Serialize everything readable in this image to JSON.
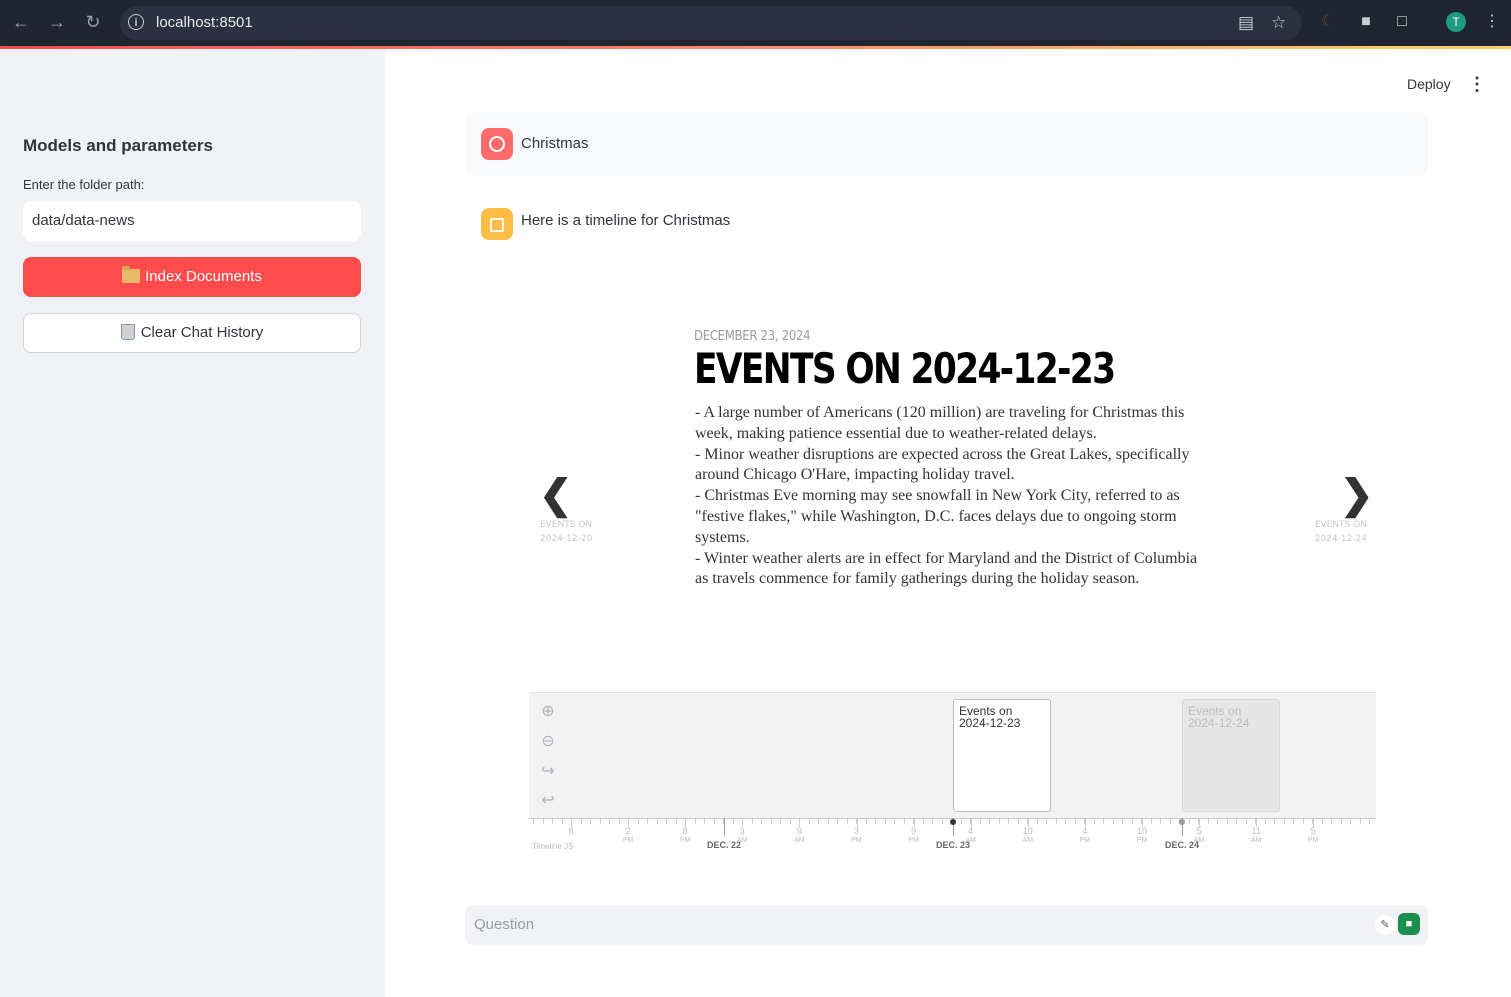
{
  "browser": {
    "url": "localhost:8501",
    "profile_initial": "T"
  },
  "sidebar": {
    "title": "Models and parameters",
    "folder_label": "Enter the folder path:",
    "folder_value": "data/data-news",
    "index_button": "Index Documents",
    "clear_button": "Clear Chat History"
  },
  "header": {
    "deploy_label": "Deploy"
  },
  "chat": {
    "user_message": "Christmas",
    "bot_message": "Here is a timeline for Christmas",
    "input_placeholder": "Question"
  },
  "timeline": {
    "date": "DECEMBER 23, 2024",
    "headline": "EVENTS ON 2024-12-23",
    "body": [
      "- A large number of Americans (120 million) are traveling for Christmas this week, making patience essential due to weather-related delays.",
      "- Minor weather disruptions are expected across the Great Lakes, specifically around Chicago O'Hare, impacting holiday travel.",
      "- Christmas Eve morning may see snowfall in New York City, referred to as \"festive flakes,\" while Washington, D.C. faces delays due to ongoing storm systems.",
      "- Winter weather alerts are in effect for Maryland and the District of Columbia as travels commence for family gatherings during the holiday season."
    ],
    "prev_label": "EVENTS ON 2024-12-20",
    "next_label": "EVENTS ON 2024-12-24",
    "markers": {
      "active": "Events on 2024-12-23",
      "inactive": "Events on 2024-12-24"
    },
    "scale_note": "Timeline JS",
    "ticks": [
      {
        "num": "8",
        "ampm": ""
      },
      {
        "num": "2",
        "ampm": "PM"
      },
      {
        "num": "8",
        "ampm": "PM"
      },
      {
        "num": "3",
        "ampm": "AM"
      },
      {
        "num": "9",
        "ampm": "AM"
      },
      {
        "num": "3",
        "ampm": "PM"
      },
      {
        "num": "9",
        "ampm": "PM"
      },
      {
        "num": "4",
        "ampm": "AM"
      },
      {
        "num": "10",
        "ampm": "AM"
      },
      {
        "num": "4",
        "ampm": "PM"
      },
      {
        "num": "10",
        "ampm": "PM"
      },
      {
        "num": "5",
        "ampm": "AM"
      },
      {
        "num": "11",
        "ampm": "AM"
      },
      {
        "num": "5",
        "ampm": "PM"
      }
    ],
    "days": [
      "DEC. 22",
      "DEC. 23",
      "DEC. 24"
    ]
  }
}
